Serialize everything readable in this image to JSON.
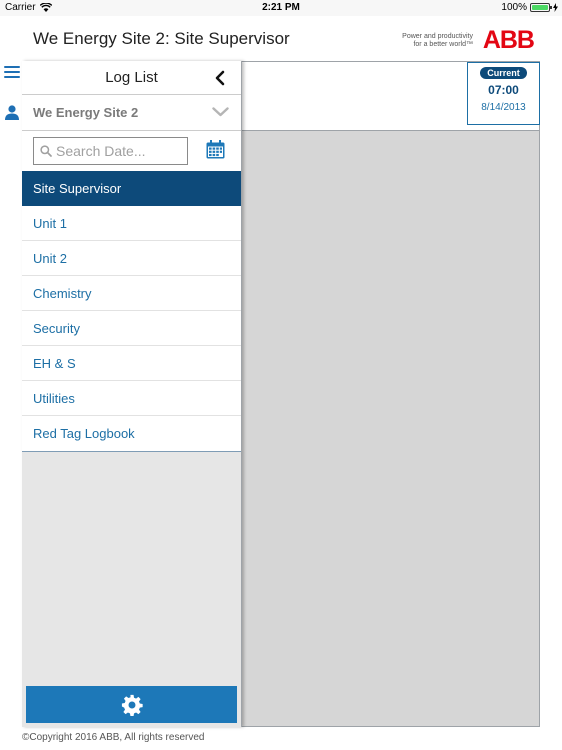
{
  "status_bar": {
    "carrier": "Carrier",
    "time": "2:21 PM",
    "battery": "100%"
  },
  "header": {
    "title": "We Energy Site 2: Site Supervisor",
    "tagline_line1": "Power and productivity",
    "tagline_line2": "for a better world™",
    "logo_text": "ABB"
  },
  "current": {
    "badge": "Current",
    "time": "07:00",
    "date": "8/14/2013"
  },
  "drawer": {
    "title": "Log List",
    "site": "We Energy Site 2",
    "search_placeholder": "Search Date...",
    "items": [
      {
        "label": "Site Supervisor"
      },
      {
        "label": "Unit 1"
      },
      {
        "label": "Unit 2"
      },
      {
        "label": "Chemistry"
      },
      {
        "label": "Security"
      },
      {
        "label": "EH & S"
      },
      {
        "label": "Utilities"
      },
      {
        "label": "Red Tag Logbook"
      }
    ]
  },
  "footer": {
    "copyright": "©Copyright 2016 ABB, All rights reserved"
  },
  "colors": {
    "accent": "#1d78b8",
    "active_item": "#0d4a7a",
    "link_text": "#1d6fa5",
    "brand_red": "#e30613"
  }
}
